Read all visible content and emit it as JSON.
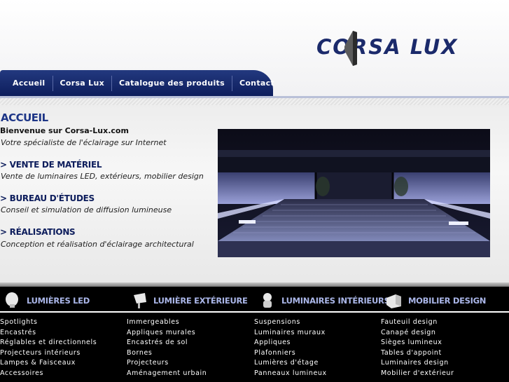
{
  "logo": {
    "text": "CORSA LUX",
    "icon": "corsa-lux-logo-mark"
  },
  "nav": [
    {
      "label": "Accueil"
    },
    {
      "label": "Corsa Lux"
    },
    {
      "label": "Catalogue des produits"
    },
    {
      "label": "Contact"
    }
  ],
  "main": {
    "title": "ACCUEIL",
    "welcome": "Bienvenue sur Corsa-Lux.com",
    "tagline": "Votre spécialiste de l'éclairage sur Internet",
    "sections": [
      {
        "title": "> VENTE DE MATÉRIEL",
        "desc": "Vente de luminaires LED, extérieurs, mobilier design"
      },
      {
        "title": "> BUREAU D'ÉTUDES",
        "desc": "Conseil et simulation de diffusion lumineuse"
      },
      {
        "title": "> RÉALISATIONS",
        "desc": "Conception et réalisation d'éclairage architectural"
      }
    ]
  },
  "categories": [
    {
      "title": "LUMIÈRES LED",
      "icon": "led-bulb-icon",
      "items": [
        "Spotlights",
        "Encastrés",
        "Réglables et directionnels",
        "Projecteurs intérieurs",
        "Lampes & Faisceaux",
        "Accessoires"
      ]
    },
    {
      "title": "LUMIÈRE EXTÉRIEURE",
      "icon": "outdoor-spotlight-icon",
      "items": [
        "Immergeables",
        "Appliques murales",
        "Encastrés de sol",
        "Bornes",
        "Projecteurs",
        "Aménagement urbain"
      ]
    },
    {
      "title": "LUMINAIRES INTÉRIEURS",
      "icon": "interior-lamp-icon",
      "items": [
        "Suspensions",
        "Luminaires muraux",
        "Appliques",
        "Plafonniers",
        "Lumières d'étage",
        "Panneaux lumineux"
      ]
    },
    {
      "title": "MOBILIER DESIGN",
      "icon": "design-furniture-icon",
      "items": [
        "Fauteuil design",
        "Canapé design",
        "Sièges lumineux",
        "Tables d'appoint",
        "Luminaires design",
        "Mobilier d'extérieur"
      ]
    }
  ],
  "colors": {
    "brand_navy": "#0d1d5c",
    "title_blue": "#1e3687",
    "category_label": "#aab6e8"
  }
}
